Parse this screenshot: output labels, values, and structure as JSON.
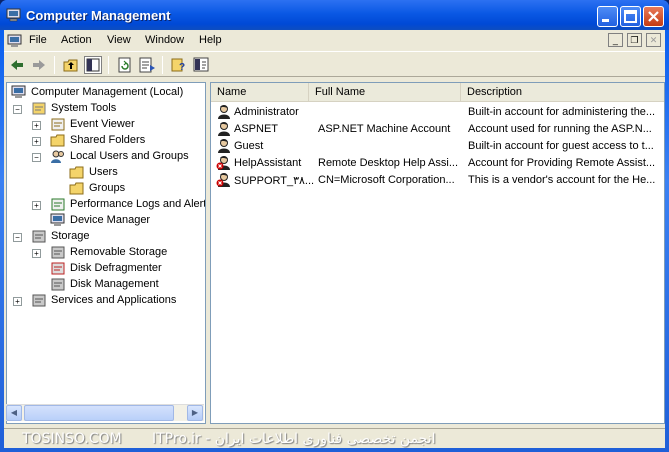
{
  "window": {
    "title": "Computer Management"
  },
  "menu": {
    "items": [
      "File",
      "Action",
      "View",
      "Window",
      "Help"
    ]
  },
  "toolbar": {
    "icons": [
      "back-icon",
      "forward-icon",
      "up-folder-icon",
      "show-hide-tree-icon",
      "refresh-icon",
      "export-list-icon",
      "help-icon",
      "properties-icon"
    ]
  },
  "tree": {
    "items": [
      {
        "label": "Computer Management (Local)",
        "icon": "computer-icon",
        "level": 0,
        "expander": ""
      },
      {
        "label": "System Tools",
        "icon": "tools-icon",
        "level": 1,
        "expander": "-"
      },
      {
        "label": "Event Viewer",
        "icon": "event-viewer-icon",
        "level": 2,
        "expander": "+"
      },
      {
        "label": "Shared Folders",
        "icon": "shared-folder-icon",
        "level": 2,
        "expander": "+"
      },
      {
        "label": "Local Users and Groups",
        "icon": "users-groups-icon",
        "level": 2,
        "expander": "-"
      },
      {
        "label": "Users",
        "icon": "folder-icon",
        "level": 3,
        "expander": "",
        "selected": true
      },
      {
        "label": "Groups",
        "icon": "folder-icon",
        "level": 3,
        "expander": ""
      },
      {
        "label": "Performance Logs and Alerts",
        "icon": "performance-icon",
        "level": 2,
        "expander": "+"
      },
      {
        "label": "Device Manager",
        "icon": "device-manager-icon",
        "level": 2,
        "expander": ""
      },
      {
        "label": "Storage",
        "icon": "storage-icon",
        "level": 1,
        "expander": "-"
      },
      {
        "label": "Removable Storage",
        "icon": "removable-storage-icon",
        "level": 2,
        "expander": "+"
      },
      {
        "label": "Disk Defragmenter",
        "icon": "defrag-icon",
        "level": 2,
        "expander": ""
      },
      {
        "label": "Disk Management",
        "icon": "disk-icon",
        "level": 2,
        "expander": ""
      },
      {
        "label": "Services and Applications",
        "icon": "services-icon",
        "level": 1,
        "expander": "+"
      }
    ]
  },
  "list": {
    "columns": [
      "Name",
      "Full Name",
      "Description"
    ],
    "rows": [
      {
        "name": "Administrator",
        "full_name": "",
        "description": "Built-in account for administering the...",
        "disabled": false
      },
      {
        "name": "ASPNET",
        "full_name": "ASP.NET Machine Account",
        "description": "Account used for running the ASP.N...",
        "disabled": false
      },
      {
        "name": "Guest",
        "full_name": "",
        "description": "Built-in account for guest access to t...",
        "disabled": false
      },
      {
        "name": "HelpAssistant",
        "full_name": "Remote Desktop Help Assi...",
        "description": "Account for Providing Remote Assist...",
        "disabled": true
      },
      {
        "name": "SUPPORT_٣٨...",
        "full_name": "CN=Microsoft Corporation...",
        "description": "This is a vendor's account for the He...",
        "disabled": true
      }
    ]
  },
  "status": {
    "watermark_left": "TOSINSO.COM",
    "watermark_right": "انجمن تخصصی فناوری اطلاعات ایران - ITPro.ir"
  },
  "colors": {
    "titlebar": "#0A58E4",
    "selection": "#FFFFFF",
    "disabled_badge": "#CC0000"
  }
}
